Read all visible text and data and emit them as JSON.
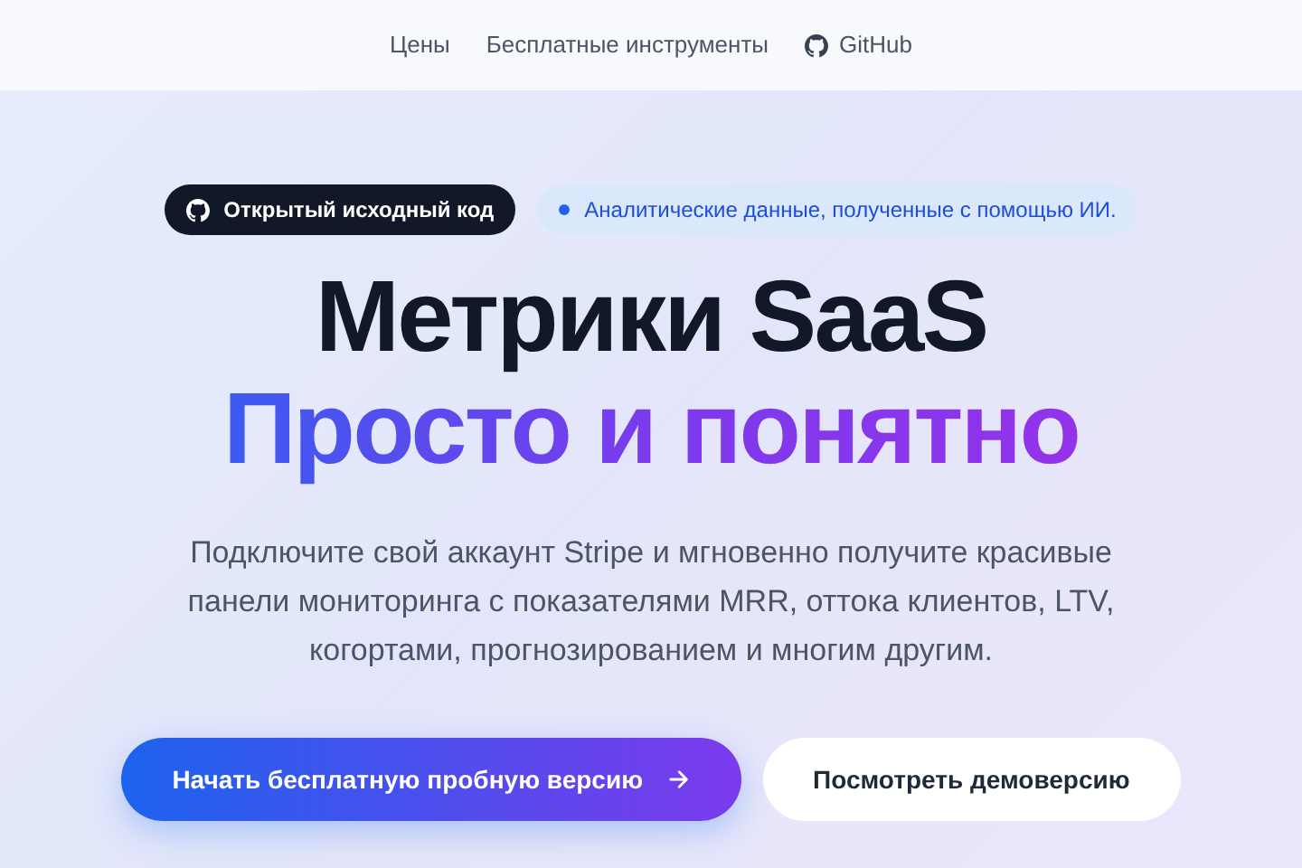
{
  "nav": {
    "links": [
      {
        "label": "Цены"
      },
      {
        "label": "Бесплатные инструменты"
      },
      {
        "label": "GitHub",
        "kind": "github"
      }
    ]
  },
  "badges": [
    {
      "kind": "github",
      "label": "Открытый исходный код"
    },
    {
      "kind": "dot",
      "label": "Аналитические данные, полученные с помощью ИИ."
    }
  ],
  "headline": {
    "line_1": "Метрики SaaS",
    "line_2": "Просто и понятно"
  },
  "description": "Подключите свой аккаунт Stripe и мгновенно получите красивые панели мониторинга с показателями MRR, оттока клиентов, LTV, когортами, прогнозированием и многим другим.",
  "buttons": [
    {
      "kind": "primary",
      "label": "Начать бесплатную пробную версию"
    },
    {
      "kind": "secondary",
      "label": "Посмотреть демоверсию"
    }
  ]
}
